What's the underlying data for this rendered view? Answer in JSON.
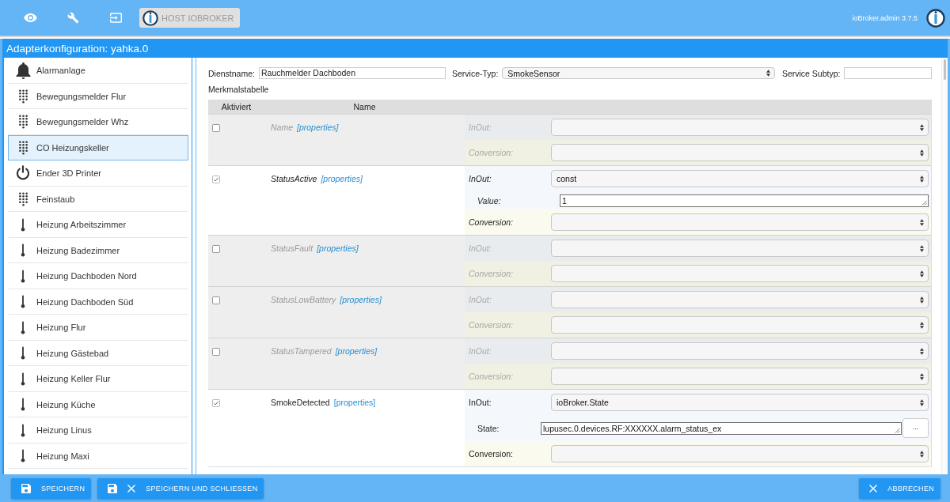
{
  "top_bar": {
    "host_button": "HOST IOBROKER",
    "version": "ioBroker.admin 3.7.5"
  },
  "dialog": {
    "title": "Adapterkonfiguration: yahka.0"
  },
  "devices": [
    {
      "name": "Alarmanlage",
      "kind": "security",
      "selected": false
    },
    {
      "name": "Bewegungsmelder Flur",
      "kind": "sensor",
      "selected": false
    },
    {
      "name": "Bewegungsmelder Whz",
      "kind": "sensor",
      "selected": false
    },
    {
      "name": "CO Heizungskeller",
      "kind": "sensor",
      "selected": true
    },
    {
      "name": "Ender 3D Printer",
      "kind": "outlet",
      "selected": false
    },
    {
      "name": "Feinstaub",
      "kind": "sensor",
      "selected": false
    },
    {
      "name": "Heizung Arbeitszimmer",
      "kind": "thermostat",
      "selected": false
    },
    {
      "name": "Heizung Badezimmer",
      "kind": "thermostat",
      "selected": false
    },
    {
      "name": "Heizung Dachboden Nord",
      "kind": "thermostat",
      "selected": false
    },
    {
      "name": "Heizung Dachboden Süd",
      "kind": "thermostat",
      "selected": false
    },
    {
      "name": "Heizung Flur",
      "kind": "thermostat",
      "selected": false
    },
    {
      "name": "Heizung Gästebad",
      "kind": "thermostat",
      "selected": false
    },
    {
      "name": "Heizung Keller Flur",
      "kind": "thermostat",
      "selected": false
    },
    {
      "name": "Heizung Küche",
      "kind": "thermostat",
      "selected": false
    },
    {
      "name": "Heizung Linus",
      "kind": "thermostat",
      "selected": false
    },
    {
      "name": "Heizung Maxi",
      "kind": "thermostat",
      "selected": false
    }
  ],
  "service": {
    "name_label": "Dienstname:",
    "name_value": "Rauchmelder Dachboden",
    "type_label": "Service-Typ:",
    "type_value": "SmokeSensor",
    "subtype_label": "Service Subtyp:"
  },
  "table": {
    "title": "Merkmalstabelle",
    "columns": [
      "Aktiviert",
      "Name"
    ],
    "rows": [
      {
        "name": "Name",
        "link": "[properties]",
        "enabled": false,
        "optional": true,
        "inout": [
          {
            "kind": "select",
            "label": "InOut:"
          }
        ],
        "conversion": {
          "label": "Conversion:"
        }
      },
      {
        "name": "StatusActive",
        "link": "[properties]",
        "enabled": true,
        "optional": true,
        "inout": [
          {
            "kind": "select",
            "label": "InOut:",
            "value": "const"
          },
          {
            "kind": "text",
            "label": "Value:",
            "value": "1"
          }
        ],
        "conversion": {
          "label": "Conversion:"
        }
      },
      {
        "name": "StatusFault",
        "link": "[properties]",
        "enabled": false,
        "optional": true,
        "inout": [
          {
            "kind": "select",
            "label": "InOut:"
          }
        ],
        "conversion": {
          "label": "Conversion:"
        }
      },
      {
        "name": "StatusLowBattery",
        "link": "[properties]",
        "enabled": false,
        "optional": true,
        "inout": [
          {
            "kind": "select",
            "label": "InOut:"
          }
        ],
        "conversion": {
          "label": "Conversion:"
        }
      },
      {
        "name": "StatusTampered",
        "link": "[properties]",
        "enabled": false,
        "optional": true,
        "inout": [
          {
            "kind": "select",
            "label": "InOut:"
          }
        ],
        "conversion": {
          "label": "Conversion:"
        }
      },
      {
        "name": "SmokeDetected",
        "link": "[properties]",
        "enabled": true,
        "optional": false,
        "inout": [
          {
            "kind": "select",
            "label": "InOut:",
            "value": "ioBroker.State"
          },
          {
            "kind": "browse",
            "label": "State:",
            "value": "lupusec.0.devices.RF:XXXXXX.alarm_status_ex",
            "button": "..."
          }
        ],
        "conversion": {
          "label": "Conversion:"
        }
      }
    ]
  },
  "buttons": [
    {
      "label": "SPEICHERN",
      "kind": "save"
    },
    {
      "label": "SPEICHERN UND SCHLIESSEN",
      "kind": "save_close"
    },
    {
      "label": "ABBRECHEN",
      "kind": "cancel"
    }
  ]
}
